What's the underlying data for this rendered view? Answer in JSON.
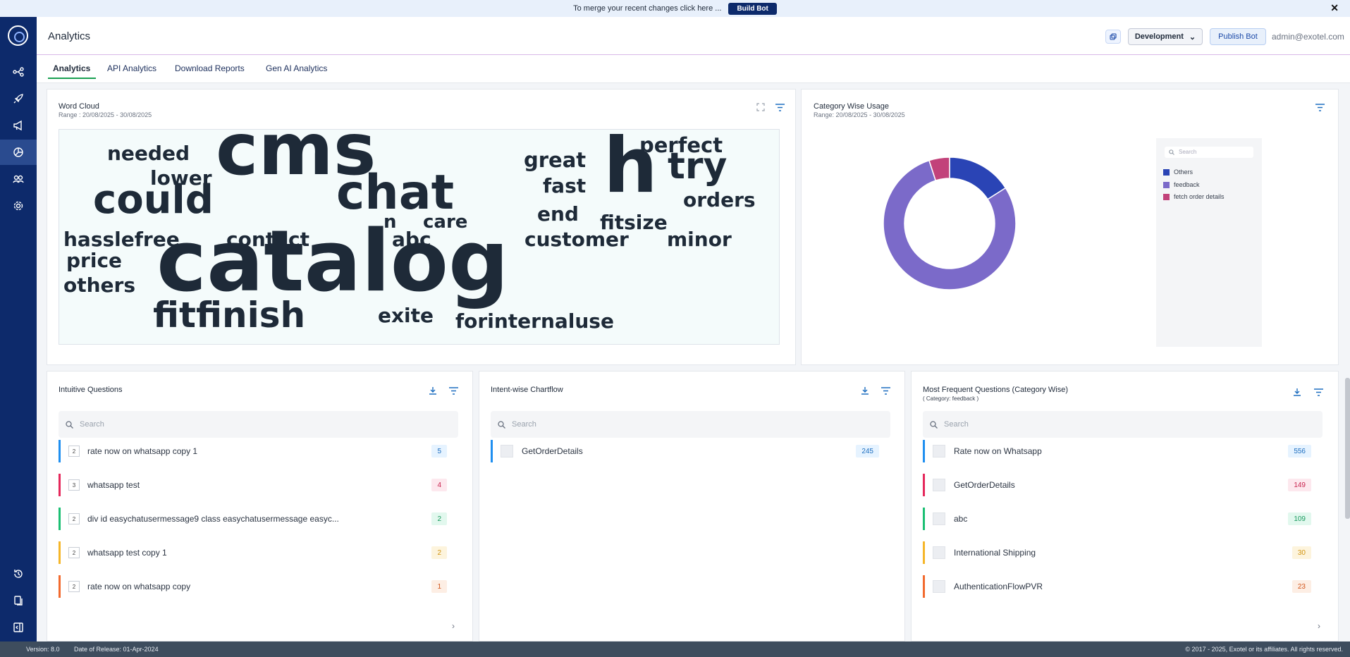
{
  "banner": {
    "message": "To merge your recent changes click here ...",
    "button_label": "Build Bot",
    "close": "✕"
  },
  "header": {
    "title": "Analytics",
    "environment": "Development",
    "publish_label": "Publish Bot",
    "user_email": "admin@exotel.com"
  },
  "tabs": [
    {
      "label": "Analytics",
      "active": true
    },
    {
      "label": "API Analytics",
      "active": false
    },
    {
      "label": "Download Reports",
      "active": false
    },
    {
      "label": "Gen AI Analytics",
      "active": false
    }
  ],
  "sidebar": {
    "icons": [
      "flow-icon",
      "rocket-icon",
      "megaphone-icon",
      "analytics-icon",
      "users-icon",
      "settings-icon",
      "history-icon",
      "documents-icon",
      "collapse-icon"
    ],
    "active": "analytics-icon"
  },
  "word_cloud": {
    "title": "Word Cloud",
    "range": "Range : 20/08/2025 - 30/08/2025",
    "words": [
      "cms",
      "catalog",
      "chat",
      "could",
      "h",
      "try",
      "perfect",
      "great",
      "needed",
      "lower",
      "fast",
      "end",
      "orders",
      "fitsize",
      "n",
      "care",
      "hasslefree",
      "contact",
      "abc",
      "customer",
      "minor",
      "price",
      "others",
      "fitfinish",
      "exite",
      "forinternaluse"
    ]
  },
  "category_usage": {
    "title": "Category Wise Usage",
    "range": "Range: 20/08/2025 - 30/08/2025",
    "search_placeholder": "Search",
    "legend": [
      {
        "name": "Others",
        "color": "#2a44b5"
      },
      {
        "name": "feedback",
        "color": "#7b6ac9"
      },
      {
        "name": "fetch order details",
        "color": "#c2427a"
      }
    ]
  },
  "chart_data": {
    "type": "pie",
    "title": "Category Wise Usage",
    "categories": [
      "Others",
      "feedback",
      "fetch order details"
    ],
    "values": [
      16,
      79,
      5
    ],
    "donut": true
  },
  "intuitive_questions": {
    "title": "Intuitive Questions",
    "search_placeholder": "Search",
    "items": [
      {
        "num": "2",
        "label": "rate now on whatsapp copy 1",
        "count": "5",
        "color": "#1f8ff0",
        "badge_bg": "#e6f3ff",
        "badge_fg": "#1f6fc0"
      },
      {
        "num": "3",
        "label": "whatsapp test",
        "count": "4",
        "color": "#e5285b",
        "badge_bg": "#fde8ee",
        "badge_fg": "#c8244f"
      },
      {
        "num": "2",
        "label": "div id easychatusermessage9 class easychatusermessage easyc...",
        "count": "2",
        "color": "#1bbf73",
        "badge_bg": "#e2f8ee",
        "badge_fg": "#1a9a5e"
      },
      {
        "num": "2",
        "label": "whatsapp test copy 1",
        "count": "2",
        "color": "#f5b629",
        "badge_bg": "#fdf4dd",
        "badge_fg": "#d19412"
      },
      {
        "num": "2",
        "label": "rate now on whatsapp copy",
        "count": "1",
        "color": "#f26a2e",
        "badge_bg": "#fdeee4",
        "badge_fg": "#d2561c"
      }
    ]
  },
  "intent_chartflow": {
    "title": "Intent-wise Chartflow",
    "search_placeholder": "Search",
    "items": [
      {
        "label": "GetOrderDetails",
        "count": "245",
        "color": "#1f8ff0",
        "badge_bg": "#e6f3ff",
        "badge_fg": "#1f6fc0"
      }
    ]
  },
  "frequent_questions": {
    "title": "Most Frequent Questions (Category Wise)",
    "subtitle": "( Category: feedback )",
    "search_placeholder": "Search",
    "items": [
      {
        "label": "Rate now on Whatsapp",
        "count": "556",
        "color": "#1f8ff0",
        "badge_bg": "#e6f3ff",
        "badge_fg": "#1f6fc0"
      },
      {
        "label": "GetOrderDetails",
        "count": "149",
        "color": "#e5285b",
        "badge_bg": "#fde8ee",
        "badge_fg": "#c8244f"
      },
      {
        "label": "abc",
        "count": "109",
        "color": "#1bbf73",
        "badge_bg": "#e2f8ee",
        "badge_fg": "#1a9a5e"
      },
      {
        "label": "International Shipping",
        "count": "30",
        "color": "#f5b629",
        "badge_bg": "#fdf4dd",
        "badge_fg": "#d19412"
      },
      {
        "label": "AuthenticationFlowPVR",
        "count": "23",
        "color": "#f26a2e",
        "badge_bg": "#fdeee4",
        "badge_fg": "#d2561c"
      }
    ]
  },
  "footer": {
    "version": "Version: 8.0",
    "release": "Date of Release: 01-Apr-2024",
    "copyright": "© 2017 - 2025, Exotel or its affiliates. All rights reserved."
  }
}
